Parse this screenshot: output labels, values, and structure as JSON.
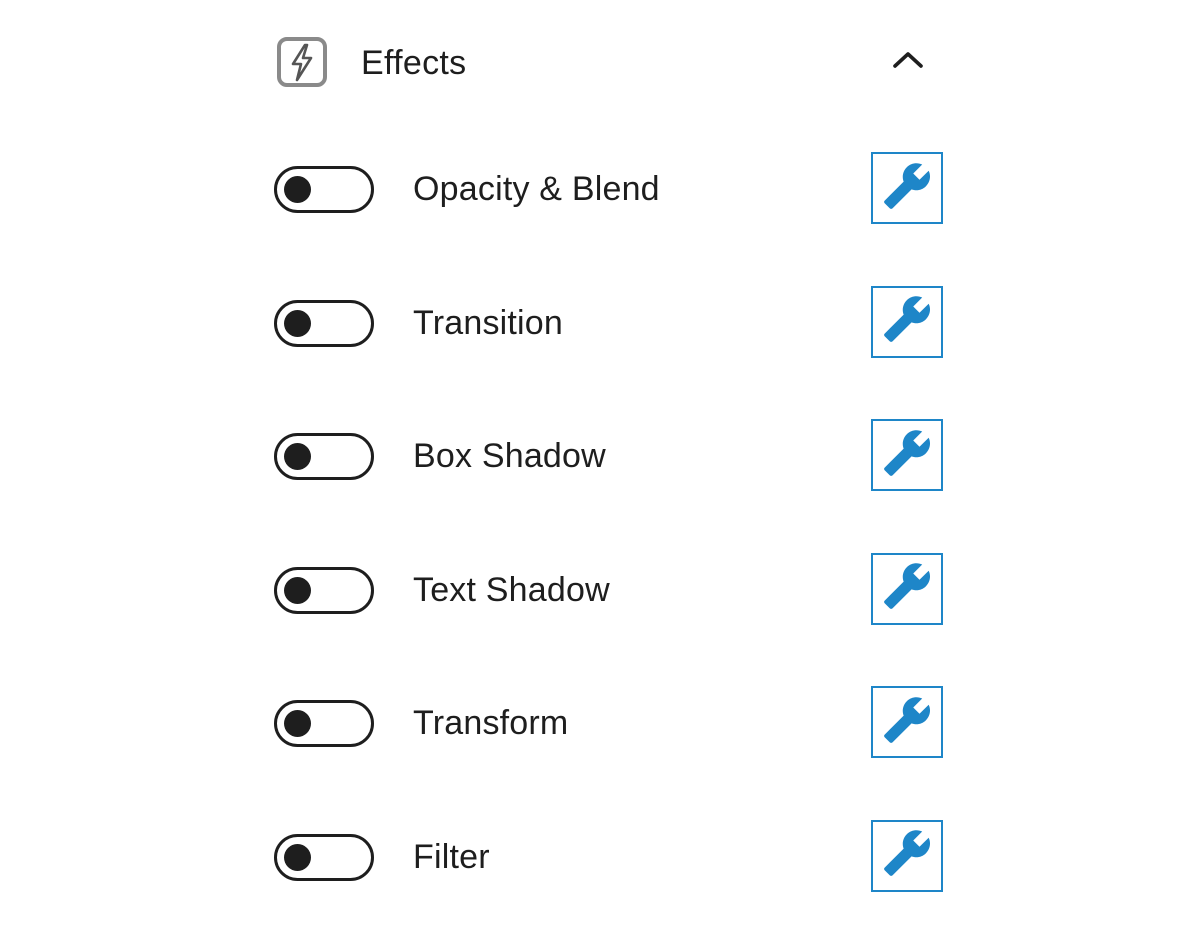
{
  "panel": {
    "title": "Effects",
    "header_icon": "lightning-bolt-icon",
    "collapse_icon": "chevron-up-icon",
    "expanded": true
  },
  "effects": [
    {
      "label": "Opacity & Blend",
      "enabled": false,
      "action_icon": "wrench-icon"
    },
    {
      "label": "Transition",
      "enabled": false,
      "action_icon": "wrench-icon"
    },
    {
      "label": "Box Shadow",
      "enabled": false,
      "action_icon": "wrench-icon"
    },
    {
      "label": "Text Shadow",
      "enabled": false,
      "action_icon": "wrench-icon"
    },
    {
      "label": "Transform",
      "enabled": false,
      "action_icon": "wrench-icon"
    },
    {
      "label": "Filter",
      "enabled": false,
      "action_icon": "wrench-icon"
    }
  ],
  "colors": {
    "text": "#1e1e1e",
    "accent": "#1e86c8",
    "icon_gray": "#8a8a8a",
    "background": "#ffffff"
  }
}
